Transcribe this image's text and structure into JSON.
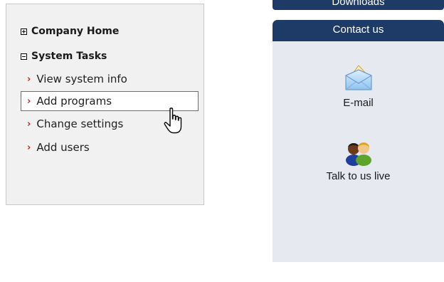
{
  "task_panel": {
    "sections": [
      {
        "label": "Company Home",
        "state": "collapsed"
      },
      {
        "label": "System Tasks",
        "state": "expanded"
      }
    ],
    "tasks": [
      {
        "label": "View system info"
      },
      {
        "label": "Add programs",
        "hovered": true
      },
      {
        "label": "Change settings"
      },
      {
        "label": "Add users"
      }
    ]
  },
  "contact_panel": {
    "downloads_tab": "Downloads",
    "contact_tab": "Contact us",
    "email_label": "E-mail",
    "chat_label": "Talk to us live"
  },
  "colors": {
    "tab_background": "#1e3a66",
    "panel_background": "#e6e9f0",
    "bullet": "#d01d00"
  },
  "cursor": "hand-pointer-icon"
}
